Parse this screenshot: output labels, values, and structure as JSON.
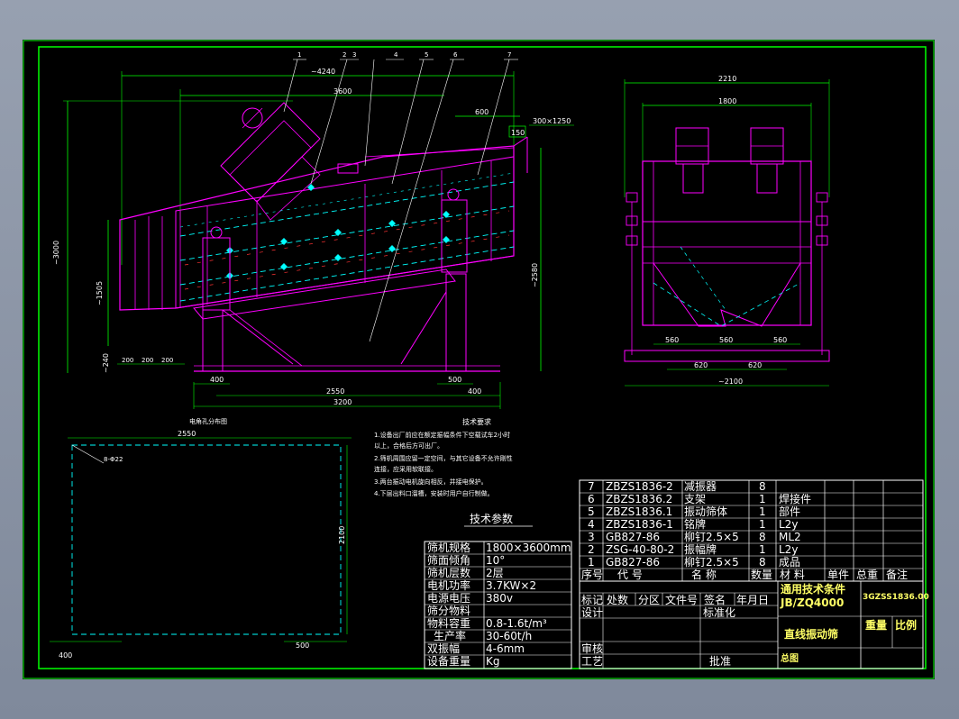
{
  "drawing": {
    "front_view": {
      "overall_length": "~4240",
      "screen_length": "3600",
      "outlet_dim": "600",
      "outlet_size": "300×1250",
      "outlet_height": "150",
      "height_total": "~3000",
      "height_right": "~2580",
      "feed_height": "~1505",
      "base_height": "~240",
      "base_widths": [
        "200",
        "200",
        "200"
      ],
      "foot_dims": [
        "400",
        "500",
        "400"
      ],
      "foot_span": "2550",
      "base_length": "3200",
      "leaders": [
        "1",
        "2",
        "3",
        "4",
        "5",
        "6",
        "7"
      ]
    },
    "side_view": {
      "overall_width": "2210",
      "screen_width": "1800",
      "bottom_segments": [
        "560",
        "560",
        "560"
      ],
      "foot_segments": [
        "620",
        "620"
      ],
      "overall_bottom": "~2100"
    },
    "motor_hole_plan": {
      "title": "电角孔分布图",
      "length": "2550",
      "width": "2100",
      "hole": "8-Φ22",
      "edge_left": "400",
      "edge_right": "500"
    },
    "tech_requirements": {
      "title": "技术要求",
      "lines": [
        "1.设备出厂前应在额定振幅条件下空载试车2小时",
        "以上，合格后方可出厂。",
        "2.筛机周围应留一定空间，与其它设备不允许刚性",
        "连接，应采用软联接。",
        "3.两台振动电机旋向相反，并接电保护。",
        "4.下层出料口溜槽，安装时用户自行制做。"
      ]
    },
    "tech_params": {
      "title": "技术参数",
      "rows": [
        [
          "筛机规格",
          "1800×3600mm"
        ],
        [
          "筛面倾角",
          "10°"
        ],
        [
          "筛机层数",
          "2层"
        ],
        [
          "电机功率",
          "3.7KW×2"
        ],
        [
          "电源电压",
          "380v"
        ],
        [
          "筛分物料",
          ""
        ],
        [
          "物料容重",
          "0.8-1.6t/m³"
        ],
        [
          "生产率",
          "30-60t/h"
        ],
        [
          "双振幅",
          "4-6mm"
        ],
        [
          "设备重量",
          "Kg"
        ]
      ]
    },
    "bom": {
      "rows": [
        [
          "7",
          "ZBZS1836-2",
          "减振器",
          "8",
          "",
          "",
          ""
        ],
        [
          "6",
          "ZBZS1836.2",
          "支架",
          "1",
          "焊接件",
          "",
          ""
        ],
        [
          "5",
          "ZBZS1836.1",
          "振动筛体",
          "1",
          "部件",
          "",
          ""
        ],
        [
          "4",
          "ZBZS1836-1",
          "铭牌",
          "1",
          "L2y",
          "",
          ""
        ],
        [
          "3",
          "GB827-86",
          "柳钉2.5×5",
          "8",
          "ML2",
          "",
          ""
        ],
        [
          "2",
          "ZSG-40-80-2",
          "振幅牌",
          "1",
          "L2y",
          "",
          ""
        ],
        [
          "1",
          "GB827-86",
          "柳钉2.5×5",
          "8",
          "成品",
          "",
          ""
        ]
      ],
      "header": [
        "序号",
        "代 号",
        "名 称",
        "数量",
        "材 料",
        "单件",
        "总重",
        "备注"
      ]
    },
    "title_block": {
      "std_title": "通用技术条件",
      "std_code": "JB/ZQ4000",
      "drawing_no": "3GZSS1836.00",
      "product_name": "直线振动筛",
      "weight_label": "重量",
      "scale_label": "比例",
      "assembly_label": "总图",
      "rev_labels": [
        "标记",
        "处数",
        "分区",
        "文件号",
        "签名",
        "年月日"
      ],
      "design_label": "设计",
      "standardize_label": "标准化",
      "review_label": "审核",
      "process_label": "工艺",
      "approve_label": "批准"
    }
  },
  "colors": {
    "frame": "#00ff00",
    "magenta": "#ff00ff",
    "cyan": "#00ffff",
    "dim": "#00ff00",
    "red": "#ff3333",
    "yellow": "#ffff00",
    "white": "#ffffff"
  }
}
